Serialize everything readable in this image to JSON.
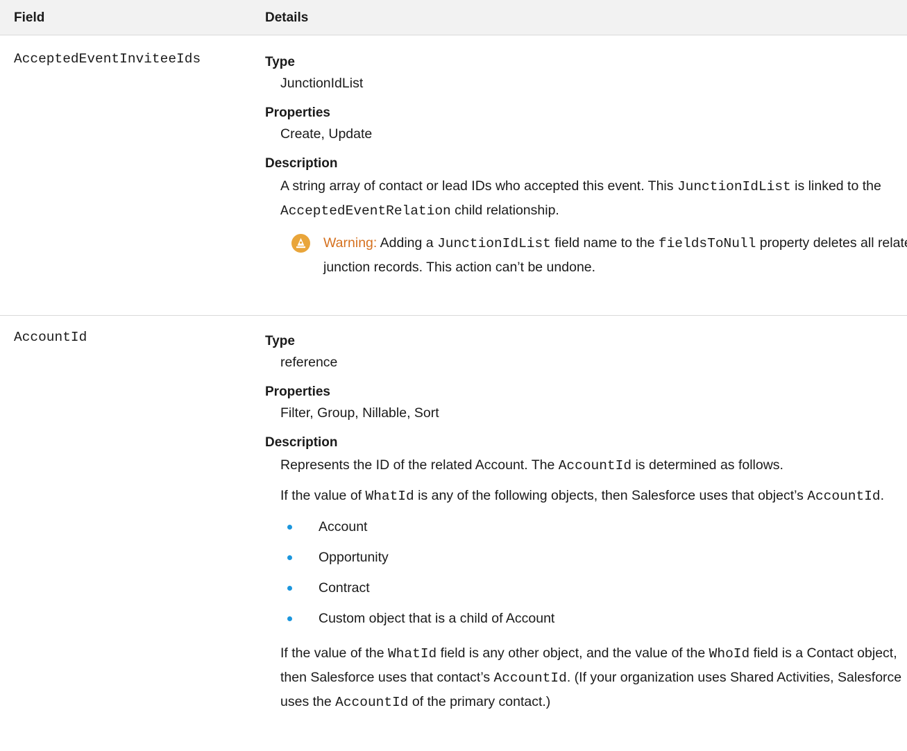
{
  "table": {
    "header": {
      "field": "Field",
      "details": "Details"
    },
    "rows": [
      {
        "field": "AcceptedEventInviteeIds",
        "type_label": "Type",
        "type": "JunctionIdList",
        "properties_label": "Properties",
        "properties": "Create, Update",
        "description_label": "Description",
        "description": {
          "t1": "A string array of contact or lead IDs who accepted this event. This ",
          "c1": "JunctionIdList",
          "t2": " is linked to the ",
          "c2": "AcceptedEventRelation",
          "t3": " child relationship."
        },
        "warning": {
          "label": "Warning:",
          "t1": " Adding a ",
          "c1": "JunctionIdList",
          "t2": " field name to the ",
          "c2": "fieldsToNull",
          "t3": " property deletes all related junction records. This action can’t be undone."
        }
      },
      {
        "field": "AccountId",
        "type_label": "Type",
        "type": "reference",
        "properties_label": "Properties",
        "properties": "Filter, Group, Nillable, Sort",
        "description_label": "Description",
        "p1": {
          "t1": "Represents the ID of the related Account. The ",
          "c1": "AccountId",
          "t2": " is determined as follows."
        },
        "p2": {
          "t1": "If the value of ",
          "c1": "WhatId",
          "t2": " is any of the following objects, then Salesforce uses that object’s ",
          "c2": "AccountId",
          "t3": "."
        },
        "objects": [
          "Account",
          "Opportunity",
          "Contract",
          "Custom object that is a child of Account"
        ],
        "p3": {
          "t1": "If the value of the ",
          "c1": "WhatId",
          "t2": " field is any other object, and the value of the ",
          "c2": "WhoId",
          "t3": " field is a Contact object, then Salesforce uses that contact’s ",
          "c3": "AccountId",
          "t4": ". (If your organization uses Shared Activities, Salesforce uses the ",
          "c4": "AccountId",
          "t5": " of the primary contact.)"
        }
      }
    ]
  },
  "colors": {
    "header_bg": "#f2f2f2",
    "warning_icon": "#e9a53a",
    "warning_label": "#d5711f",
    "bullet": "#1b96dd"
  },
  "icons": {
    "warning": "warning-icon",
    "bullet": "bullet-icon"
  }
}
